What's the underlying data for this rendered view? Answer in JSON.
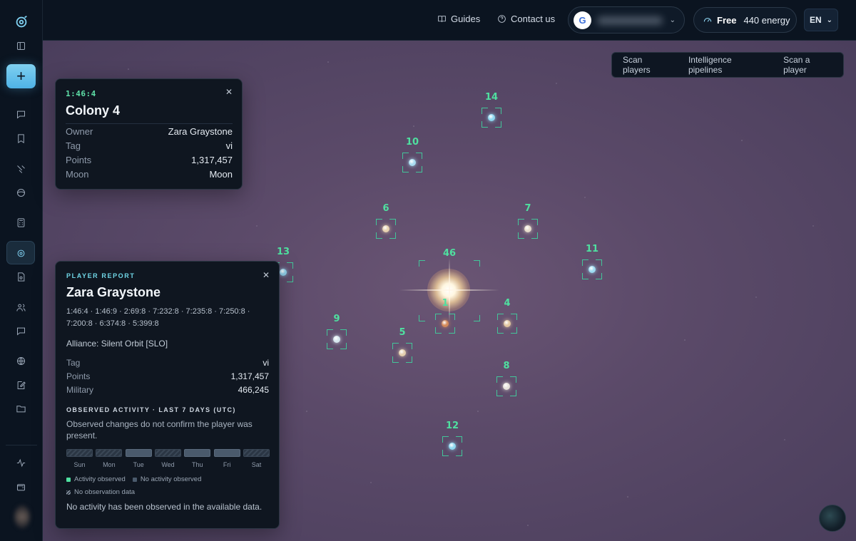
{
  "topbar": {
    "guides_label": "Guides",
    "contact_label": "Contact us",
    "account_initial": "G",
    "plan": "Free",
    "energy": "440 energy",
    "language": "EN"
  },
  "map_tabs": [
    "Scan players",
    "Intelligence pipelines",
    "Scan a player"
  ],
  "sun_label": "46",
  "planets": [
    {
      "num": "14",
      "color": "#8fd8f0"
    },
    {
      "num": "10",
      "color": "#a8dcf0"
    },
    {
      "num": "6",
      "color": "#e8d2b0"
    },
    {
      "num": "7",
      "color": "#e6dccb"
    },
    {
      "num": "13",
      "color": "#8fd0ea"
    },
    {
      "num": "11",
      "color": "#9edcf2"
    },
    {
      "num": "1",
      "color": "#d48a5a"
    },
    {
      "num": "4",
      "color": "#e2c6a0"
    },
    {
      "num": "9",
      "color": "#d6e6ee"
    },
    {
      "num": "5",
      "color": "#e4cfae"
    },
    {
      "num": "8",
      "color": "#e8e4dc"
    },
    {
      "num": "12",
      "color": "#8fd8f0"
    }
  ],
  "colony_panel": {
    "coords": "1:46:4",
    "title": "Colony 4",
    "rows": [
      {
        "key": "Owner",
        "value": "Zara Graystone"
      },
      {
        "key": "Tag",
        "value": "vi"
      },
      {
        "key": "Points",
        "value": "1,317,457"
      },
      {
        "key": "Moon",
        "value": "Moon"
      }
    ]
  },
  "player_report": {
    "label": "PLAYER REPORT",
    "name": "Zara Graystone",
    "coords": "1:46:4 · 1:46:9 · 2:69:8 · 7:232:8 · 7:235:8 · 7:250:8 · 7:200:8 · 6:374:8 · 5:399:8",
    "alliance": "Alliance: Silent Orbit [SLO]",
    "rows": [
      {
        "key": "Tag",
        "value": "vi"
      },
      {
        "key": "Points",
        "value": "1,317,457"
      },
      {
        "key": "Military",
        "value": "466,245"
      }
    ],
    "activity_title": "OBSERVED ACTIVITY · LAST 7 DAYS (UTC)",
    "activity_note": "Observed changes do not confirm the player was present.",
    "days": [
      {
        "label": "Sun",
        "state": "no-observation"
      },
      {
        "label": "Mon",
        "state": "no-observation"
      },
      {
        "label": "Tue",
        "state": "no-activity"
      },
      {
        "label": "Wed",
        "state": "no-observation"
      },
      {
        "label": "Thu",
        "state": "no-activity"
      },
      {
        "label": "Fri",
        "state": "no-activity"
      },
      {
        "label": "Sat",
        "state": "no-observation"
      }
    ],
    "legend": {
      "activity": "Activity observed",
      "no_activity": "No activity observed",
      "no_observation": "No observation data"
    },
    "footer": "No activity has been observed in the available data."
  },
  "colors": {
    "accent": "#4fe0a0",
    "brand": "#5ab8e6",
    "activity": "#4fe0a0",
    "no_activity": "#4a5a6c"
  }
}
